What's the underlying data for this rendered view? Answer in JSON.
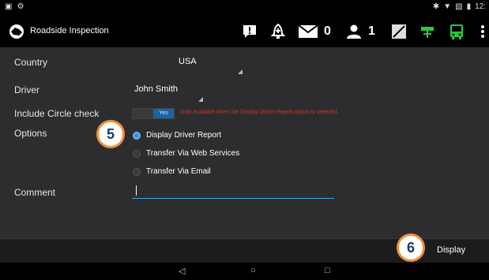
{
  "actionbar": {
    "title": "Roadside Inspection",
    "messages_count": "0",
    "users_count": "1"
  },
  "statusbar": {
    "time": "12:"
  },
  "form": {
    "country_label": "Country",
    "country_value": "USA",
    "driver_label": "Driver",
    "driver_value": "John Smith",
    "circle_label": "Include Circle check",
    "circle_toggle": "Yes",
    "circle_note": "Only available when the Display Driver Report option is selected.",
    "options_label": "Options",
    "options": [
      {
        "label": "Display Driver Report",
        "selected": true
      },
      {
        "label": "Transfer Via Web Services",
        "selected": false
      },
      {
        "label": "Transfer Via Email",
        "selected": false
      }
    ],
    "comment_label": "Comment"
  },
  "display_button": "Display",
  "callouts": [
    "5",
    "6"
  ],
  "colors": {
    "accent": "#3ba8e0",
    "toggle_on": "#1565a8",
    "note": "#d9312b",
    "callout_border": "#f0903a",
    "bus_icon": "#27c93f"
  }
}
